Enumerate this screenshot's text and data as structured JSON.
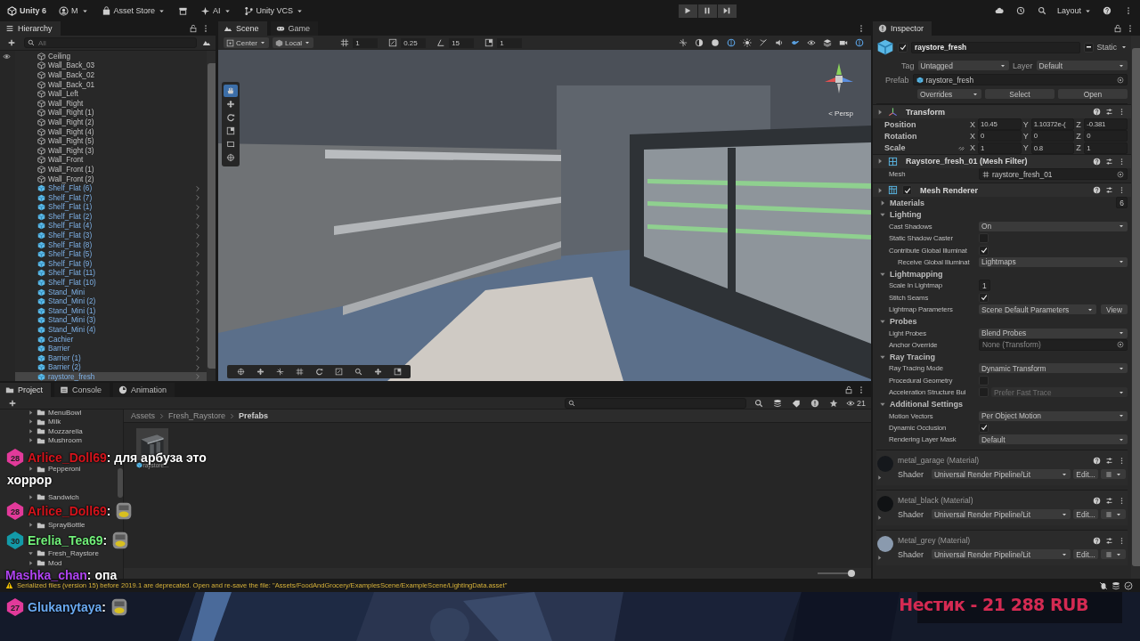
{
  "toolbar": {
    "menus": [
      {
        "kind": "unity",
        "label": "Unity 6"
      },
      {
        "kind": "account",
        "label": "M"
      },
      {
        "kind": "store",
        "label": "Asset Store"
      },
      {
        "kind": "package"
      },
      {
        "kind": "ai",
        "label": "AI"
      },
      {
        "kind": "vcs",
        "label": "Unity VCS"
      }
    ],
    "playing": false,
    "layout": "Layout"
  },
  "hierarchy": {
    "title": "Hierarchy",
    "search_placeholder": "All",
    "items": [
      {
        "name": "Ceiling",
        "kind": "object",
        "selected": false
      },
      {
        "name": "Wall_Back_03",
        "kind": "object",
        "selected": false
      },
      {
        "name": "Wall_Back_02",
        "kind": "object",
        "selected": false
      },
      {
        "name": "Wall_Back_01",
        "kind": "object",
        "selected": false
      },
      {
        "name": "Wall_Left",
        "kind": "object",
        "selected": false
      },
      {
        "name": "Wall_Right",
        "kind": "object",
        "selected": false
      },
      {
        "name": "Wall_Right (1)",
        "kind": "object",
        "selected": false
      },
      {
        "name": "Wall_Right (2)",
        "kind": "object",
        "selected": false
      },
      {
        "name": "Wall_Right (4)",
        "kind": "object",
        "selected": false
      },
      {
        "name": "Wall_Right (5)",
        "kind": "object",
        "selected": false
      },
      {
        "name": "Wall_Right (3)",
        "kind": "object",
        "selected": false
      },
      {
        "name": "Wall_Front",
        "kind": "object",
        "selected": false
      },
      {
        "name": "Wall_Front (1)",
        "kind": "object",
        "selected": false
      },
      {
        "name": "Wall_Front (2)",
        "kind": "object",
        "selected": false
      },
      {
        "name": "Shelf_Flat (6)",
        "kind": "prefab",
        "selected": false
      },
      {
        "name": "Shelf_Flat (7)",
        "kind": "prefab",
        "selected": false
      },
      {
        "name": "Shelf_Flat (1)",
        "kind": "prefab",
        "selected": false
      },
      {
        "name": "Shelf_Flat (2)",
        "kind": "prefab",
        "selected": false
      },
      {
        "name": "Shelf_Flat (4)",
        "kind": "prefab",
        "selected": false
      },
      {
        "name": "Shelf_Flat (3)",
        "kind": "prefab",
        "selected": false
      },
      {
        "name": "Shelf_Flat (8)",
        "kind": "prefab",
        "selected": false
      },
      {
        "name": "Shelf_Flat (5)",
        "kind": "prefab",
        "selected": false
      },
      {
        "name": "Shelf_Flat (9)",
        "kind": "prefab",
        "selected": false
      },
      {
        "name": "Shelf_Flat (11)",
        "kind": "prefab",
        "selected": false
      },
      {
        "name": "Shelf_Flat (10)",
        "kind": "prefab",
        "selected": false
      },
      {
        "name": "Stand_Mini",
        "kind": "prefab",
        "selected": false
      },
      {
        "name": "Stand_Mini (2)",
        "kind": "prefab",
        "selected": false
      },
      {
        "name": "Stand_Mini (1)",
        "kind": "prefab",
        "selected": false
      },
      {
        "name": "Stand_Mini (3)",
        "kind": "prefab",
        "selected": false
      },
      {
        "name": "Stand_Mini (4)",
        "kind": "prefab",
        "selected": false
      },
      {
        "name": "Cachier",
        "kind": "prefab",
        "selected": false
      },
      {
        "name": "Barrier",
        "kind": "prefab",
        "selected": false
      },
      {
        "name": "Barrier (1)",
        "kind": "prefab",
        "selected": false
      },
      {
        "name": "Barrier (2)",
        "kind": "prefab",
        "selected": false
      },
      {
        "name": "raystore_fresh",
        "kind": "prefab",
        "selected": true
      }
    ]
  },
  "scene": {
    "tabs": [
      {
        "label": "Scene",
        "kind": "scene",
        "selected": true
      },
      {
        "label": "Game",
        "kind": "game",
        "selected": false
      }
    ],
    "toolbar": {
      "pivot": "Center",
      "space": "Local",
      "grid": "1",
      "move_snap": "0.25",
      "rotate_snap": "15",
      "scale_snap": "1"
    },
    "tools": [
      {
        "kind": "view",
        "selected": true
      },
      {
        "kind": "move",
        "selected": false
      },
      {
        "kind": "rotate",
        "selected": false
      },
      {
        "kind": "scale",
        "selected": false
      },
      {
        "kind": "rect",
        "selected": false
      },
      {
        "kind": "transform",
        "selected": false
      }
    ],
    "projection": "< Persp"
  },
  "inspector": {
    "title": "Inspector",
    "object": {
      "name": "raystore_fresh",
      "active": true,
      "static_mixed": true,
      "static_label": "Static",
      "tag_label": "Tag",
      "tag": "Untagged",
      "layer_label": "Layer",
      "layer": "Default",
      "prefab_label": "Prefab",
      "prefab": "raystore_fresh",
      "overrides": "Overrides",
      "buttons": [
        "Select",
        "Open"
      ]
    },
    "transform": {
      "title": "Transform",
      "rows": [
        {
          "kind": "vector",
          "label": "Position",
          "values": [
            {
              "axis": "X",
              "value": "10.45"
            },
            {
              "axis": "Y",
              "value": "1.10372e-("
            },
            {
              "axis": "Z",
              "value": "-0.381"
            }
          ]
        },
        {
          "kind": "vector",
          "label": "Rotation",
          "values": [
            {
              "axis": "X",
              "value": "0"
            },
            {
              "axis": "Y",
              "value": "0"
            },
            {
              "axis": "Z",
              "value": "0"
            }
          ]
        },
        {
          "kind": "scale",
          "label": "Scale",
          "values": [
            {
              "axis": "X",
              "value": "1"
            },
            {
              "axis": "Y",
              "value": "0.8"
            },
            {
              "axis": "Z",
              "value": "1"
            }
          ]
        }
      ]
    },
    "mesh_filter": {
      "title": "Raystore_fresh_01 (Mesh Filter)",
      "label": "Mesh",
      "value": "raystore_fresh_01"
    },
    "mesh_renderer": {
      "title": "Mesh Renderer",
      "enabled": true,
      "props": [
        {
          "kind": "foldout",
          "label": "Materials",
          "expanded": false,
          "value": "6"
        },
        {
          "kind": "foldout",
          "label": "Lighting",
          "expanded": true
        },
        {
          "kind": "dropdown",
          "label": "Cast Shadows",
          "value": "On"
        },
        {
          "kind": "checkbox",
          "label": "Static Shadow Caster",
          "checked": false
        },
        {
          "kind": "checkbox",
          "label": "Contribute Global Illuminat",
          "checked": true
        },
        {
          "kind": "subdropdown",
          "label": "Receive Global Illuminat",
          "value": "Lightmaps"
        },
        {
          "kind": "foldout",
          "label": "Lightmapping",
          "expanded": true
        },
        {
          "kind": "field",
          "label": "Scale In Lightmap",
          "value": "1"
        },
        {
          "kind": "checkbox",
          "label": "Stitch Seams",
          "checked": true
        },
        {
          "kind": "dropdown_button",
          "label": "Lightmap Parameters",
          "value": "Scene Default Parameters",
          "button": "View"
        },
        {
          "kind": "foldout",
          "label": "Probes",
          "expanded": true
        },
        {
          "kind": "dropdown",
          "label": "Light Probes",
          "value": "Blend Probes"
        },
        {
          "kind": "object",
          "label": "Anchor Override",
          "value": "None (Transform)"
        },
        {
          "kind": "foldout",
          "label": "Ray Tracing",
          "expanded": true
        },
        {
          "kind": "dropdown",
          "label": "Ray Tracing Mode",
          "value": "Dynamic Transform"
        },
        {
          "kind": "checkbox",
          "label": "Procedural Geometry",
          "checked": false
        },
        {
          "kind": "checkbox_dropdown",
          "label": "Acceleration Structure Bui",
          "checked": false,
          "value": "Prefer Fast Trace"
        },
        {
          "kind": "foldout",
          "label": "Additional Settings",
          "expanded": true
        },
        {
          "kind": "dropdown",
          "label": "Motion Vectors",
          "value": "Per Object Motion"
        },
        {
          "kind": "checkbox",
          "label": "Dynamic Occlusion",
          "checked": true
        },
        {
          "kind": "dropdown",
          "label": "Rendering Layer Mask",
          "value": "Default"
        }
      ]
    },
    "materials": [
      {
        "name": "metal_garage (Material)",
        "color": "#15181c",
        "shader_label": "Shader",
        "shader": "Universal Render Pipeline/Lit",
        "edit": "Edit..."
      },
      {
        "name": "Metal_black (Material)",
        "color": "#101214",
        "shader_label": "Shader",
        "shader": "Universal Render Pipeline/Lit",
        "edit": "Edit..."
      },
      {
        "name": "Metal_grey (Material)",
        "color": "#8a9aae",
        "shader_label": "Shader",
        "shader": "Universal Render Pipeline/Lit",
        "edit": "Edit..."
      }
    ]
  },
  "project": {
    "tabs": [
      {
        "label": "Project",
        "kind": "project",
        "selected": true
      },
      {
        "label": "Console",
        "kind": "console",
        "selected": false
      },
      {
        "label": "Animation",
        "kind": "animation",
        "selected": false
      }
    ],
    "count": "21",
    "folders": [
      {
        "name": "MenuBowl",
        "expanded": false
      },
      {
        "name": "Milk",
        "expanded": false
      },
      {
        "name": "Mozzarella",
        "expanded": false
      },
      {
        "name": "Mushroom",
        "expanded": false
      },
      {
        "name": "Pepperoni",
        "expanded": false
      },
      {
        "name": "Sandwich",
        "expanded": false
      },
      {
        "name": "SprayBottle",
        "expanded": false
      },
      {
        "name": "Fresh_Raystore",
        "expanded": true,
        "children": [
          {
            "name": "Mod",
            "expanded": false
          }
        ]
      }
    ],
    "breadcrumb": [
      "Assets",
      "Fresh_Raystore",
      "Prefabs"
    ],
    "assets": [
      {
        "name": "raystore..."
      }
    ],
    "zoom": {
      "level": 0.9
    }
  },
  "status_bar": {
    "warning": "Serialized files (version 15) before 2019.1 are deprecated. Open and re-save the file: \"Assets/FoodAndGrocery/ExamplesScene/ExampleScene/LightingData.asset\""
  },
  "stream": {
    "chat": [
      {
        "kind": "text",
        "badge": {
          "text": "28",
          "color": "#e23a9a"
        },
        "user": "Arlice_Doll69",
        "color": "#d4141c",
        "separator": ":",
        "lines": [
          "для арбуза это",
          "хоррор"
        ]
      },
      {
        "kind": "emote",
        "badge": {
          "text": "28",
          "color": "#e23a9a"
        },
        "user": "Arlice_Doll69",
        "color": "#d4141c",
        "separator": ":"
      },
      {
        "kind": "emote",
        "badge": {
          "text": "30",
          "color": "#139aa8"
        },
        "user": "Erelia_Tea69",
        "color": "#72f07a",
        "separator": ":"
      },
      {
        "kind": "text",
        "user": "Mashka_chan",
        "color": "#b044f2",
        "separator": ":",
        "lines": [
          "опа"
        ]
      },
      {
        "kind": "emote",
        "badge": {
          "text": "27",
          "color": "#e23a9a"
        },
        "user": "Glukanytaya",
        "color": "#6aaaf2",
        "separator": ":"
      }
    ],
    "donation": "Нестик - 21 288 RUB"
  }
}
